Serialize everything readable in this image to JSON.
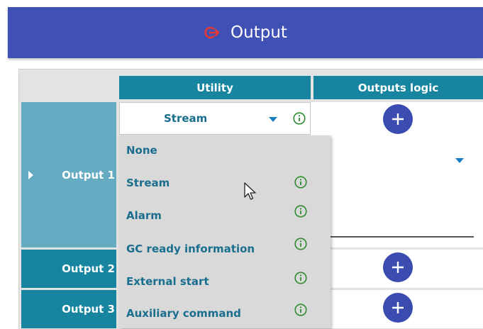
{
  "header": {
    "title": "Output",
    "icon": "logout-icon",
    "bg": "#3f51b5",
    "icon_color": "#e53935"
  },
  "table": {
    "columns": {
      "utility": "Utility",
      "outputs_logic": "Outputs logic"
    },
    "rows": [
      {
        "label": "Output 1",
        "expanded": true
      },
      {
        "label": "Output 2"
      },
      {
        "label": "Output 3"
      }
    ]
  },
  "utility_select": {
    "value": "Stream"
  },
  "dropdown": {
    "options": [
      {
        "label": "None",
        "info": false
      },
      {
        "label": "Stream",
        "info": true
      },
      {
        "label": "Alarm",
        "info": true
      },
      {
        "label": "GC ready information",
        "info": true
      },
      {
        "label": "External start",
        "info": true
      },
      {
        "label": "Auxiliary command",
        "info": true
      }
    ]
  },
  "colors": {
    "header_teal": "#1785a0",
    "row_light": "#65abc2",
    "text_teal": "#1a6e8e",
    "info_green": "#2e8b2e",
    "add_button": "#3a4cb0"
  }
}
